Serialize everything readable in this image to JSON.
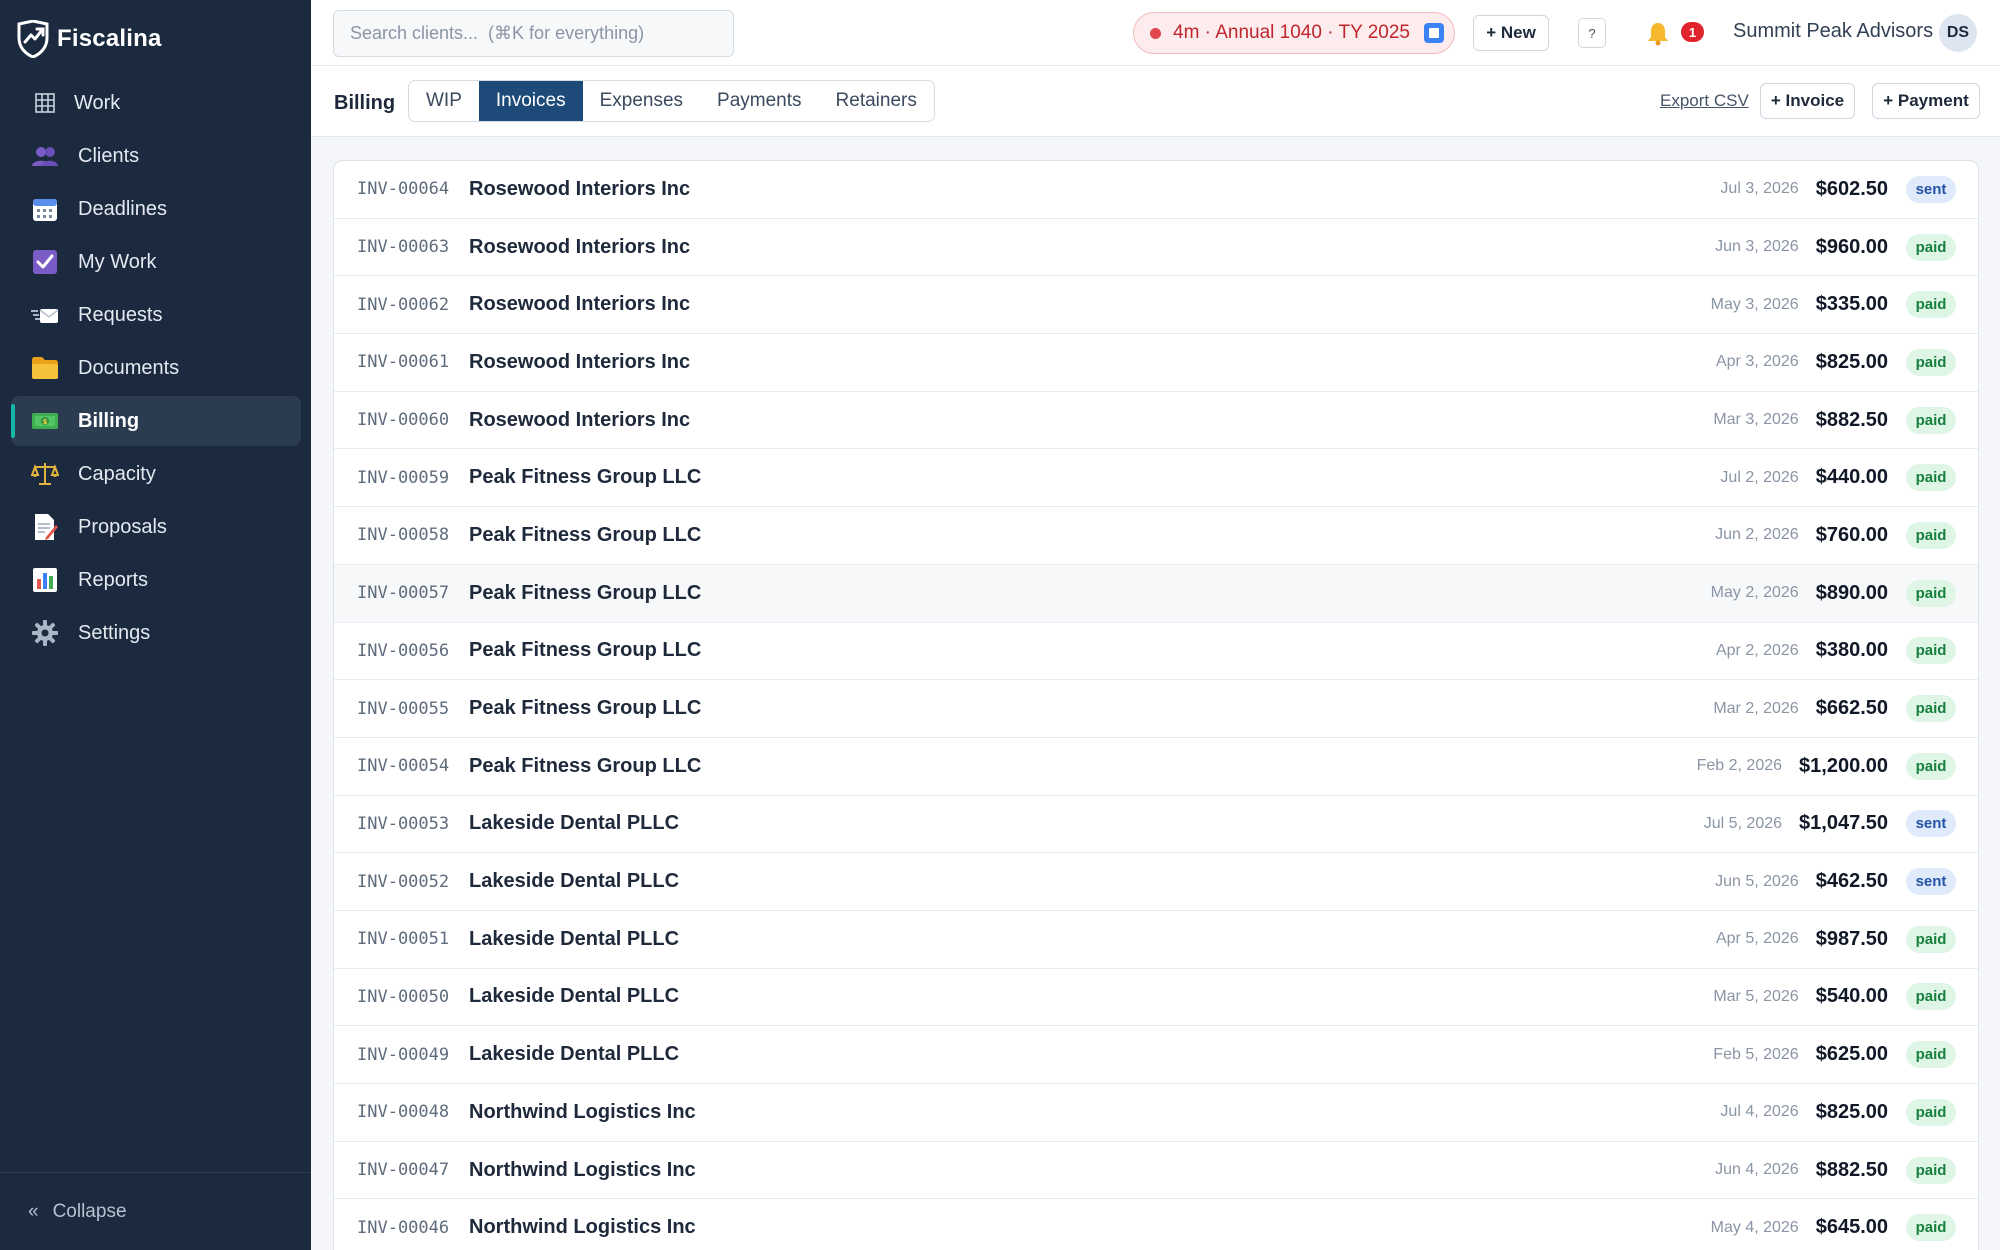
{
  "brand": {
    "name": "Fiscalina"
  },
  "sidebar": {
    "items": [
      {
        "label": "Work",
        "icon": "grid-icon"
      },
      {
        "label": "Clients",
        "icon": "users-icon"
      },
      {
        "label": "Deadlines",
        "icon": "calendar-icon"
      },
      {
        "label": "My Work",
        "icon": "checkbox-icon"
      },
      {
        "label": "Requests",
        "icon": "envelope-icon"
      },
      {
        "label": "Documents",
        "icon": "folder-icon"
      },
      {
        "label": "Billing",
        "icon": "money-icon",
        "active": true
      },
      {
        "label": "Capacity",
        "icon": "scales-icon"
      },
      {
        "label": "Proposals",
        "icon": "document-pen-icon"
      },
      {
        "label": "Reports",
        "icon": "bar-chart-icon"
      },
      {
        "label": "Settings",
        "icon": "gear-icon"
      }
    ],
    "collapse_label": "Collapse",
    "collapse_glyph": "«"
  },
  "topbar": {
    "search_placeholder": "Search clients...  (⌘K for everything)",
    "timer_label": "4m · Annual 1040 · TY 2025",
    "new_label": "+ New",
    "help_label": "?",
    "notification_count": "1",
    "firm_name": "Summit Peak Advisors",
    "avatar_initials": "DS"
  },
  "billing": {
    "title": "Billing",
    "tabs": [
      "WIP",
      "Invoices",
      "Expenses",
      "Payments",
      "Retainers"
    ],
    "active_tab": "Invoices",
    "export_label": "Export CSV",
    "add_invoice_label": "+ Invoice",
    "add_payment_label": "+ Payment"
  },
  "invoices": [
    {
      "id": "INV-00064",
      "client": "Rosewood Interiors Inc",
      "date": "Jul 3, 2026",
      "amount": "$602.50",
      "status": "sent"
    },
    {
      "id": "INV-00063",
      "client": "Rosewood Interiors Inc",
      "date": "Jun 3, 2026",
      "amount": "$960.00",
      "status": "paid"
    },
    {
      "id": "INV-00062",
      "client": "Rosewood Interiors Inc",
      "date": "May 3, 2026",
      "amount": "$335.00",
      "status": "paid"
    },
    {
      "id": "INV-00061",
      "client": "Rosewood Interiors Inc",
      "date": "Apr 3, 2026",
      "amount": "$825.00",
      "status": "paid"
    },
    {
      "id": "INV-00060",
      "client": "Rosewood Interiors Inc",
      "date": "Mar 3, 2026",
      "amount": "$882.50",
      "status": "paid"
    },
    {
      "id": "INV-00059",
      "client": "Peak Fitness Group LLC",
      "date": "Jul 2, 2026",
      "amount": "$440.00",
      "status": "paid"
    },
    {
      "id": "INV-00058",
      "client": "Peak Fitness Group LLC",
      "date": "Jun 2, 2026",
      "amount": "$760.00",
      "status": "paid"
    },
    {
      "id": "INV-00057",
      "client": "Peak Fitness Group LLC",
      "date": "May 2, 2026",
      "amount": "$890.00",
      "status": "paid"
    },
    {
      "id": "INV-00056",
      "client": "Peak Fitness Group LLC",
      "date": "Apr 2, 2026",
      "amount": "$380.00",
      "status": "paid"
    },
    {
      "id": "INV-00055",
      "client": "Peak Fitness Group LLC",
      "date": "Mar 2, 2026",
      "amount": "$662.50",
      "status": "paid"
    },
    {
      "id": "INV-00054",
      "client": "Peak Fitness Group LLC",
      "date": "Feb 2, 2026",
      "amount": "$1,200.00",
      "status": "paid"
    },
    {
      "id": "INV-00053",
      "client": "Lakeside Dental PLLC",
      "date": "Jul 5, 2026",
      "amount": "$1,047.50",
      "status": "sent"
    },
    {
      "id": "INV-00052",
      "client": "Lakeside Dental PLLC",
      "date": "Jun 5, 2026",
      "amount": "$462.50",
      "status": "sent"
    },
    {
      "id": "INV-00051",
      "client": "Lakeside Dental PLLC",
      "date": "Apr 5, 2026",
      "amount": "$987.50",
      "status": "paid"
    },
    {
      "id": "INV-00050",
      "client": "Lakeside Dental PLLC",
      "date": "Mar 5, 2026",
      "amount": "$540.00",
      "status": "paid"
    },
    {
      "id": "INV-00049",
      "client": "Lakeside Dental PLLC",
      "date": "Feb 5, 2026",
      "amount": "$625.00",
      "status": "paid"
    },
    {
      "id": "INV-00048",
      "client": "Northwind Logistics Inc",
      "date": "Jul 4, 2026",
      "amount": "$825.00",
      "status": "paid"
    },
    {
      "id": "INV-00047",
      "client": "Northwind Logistics Inc",
      "date": "Jun 4, 2026",
      "amount": "$882.50",
      "status": "paid"
    },
    {
      "id": "INV-00046",
      "client": "Northwind Logistics Inc",
      "date": "May 4, 2026",
      "amount": "$645.00",
      "status": "paid"
    }
  ],
  "colors": {
    "sidebar_bg": "#1b2a3e",
    "active_tab": "#1e4a7a",
    "accent": "#14b8a6",
    "paid": "#17803d",
    "sent": "#2554a6",
    "alert": "#e0242d"
  }
}
